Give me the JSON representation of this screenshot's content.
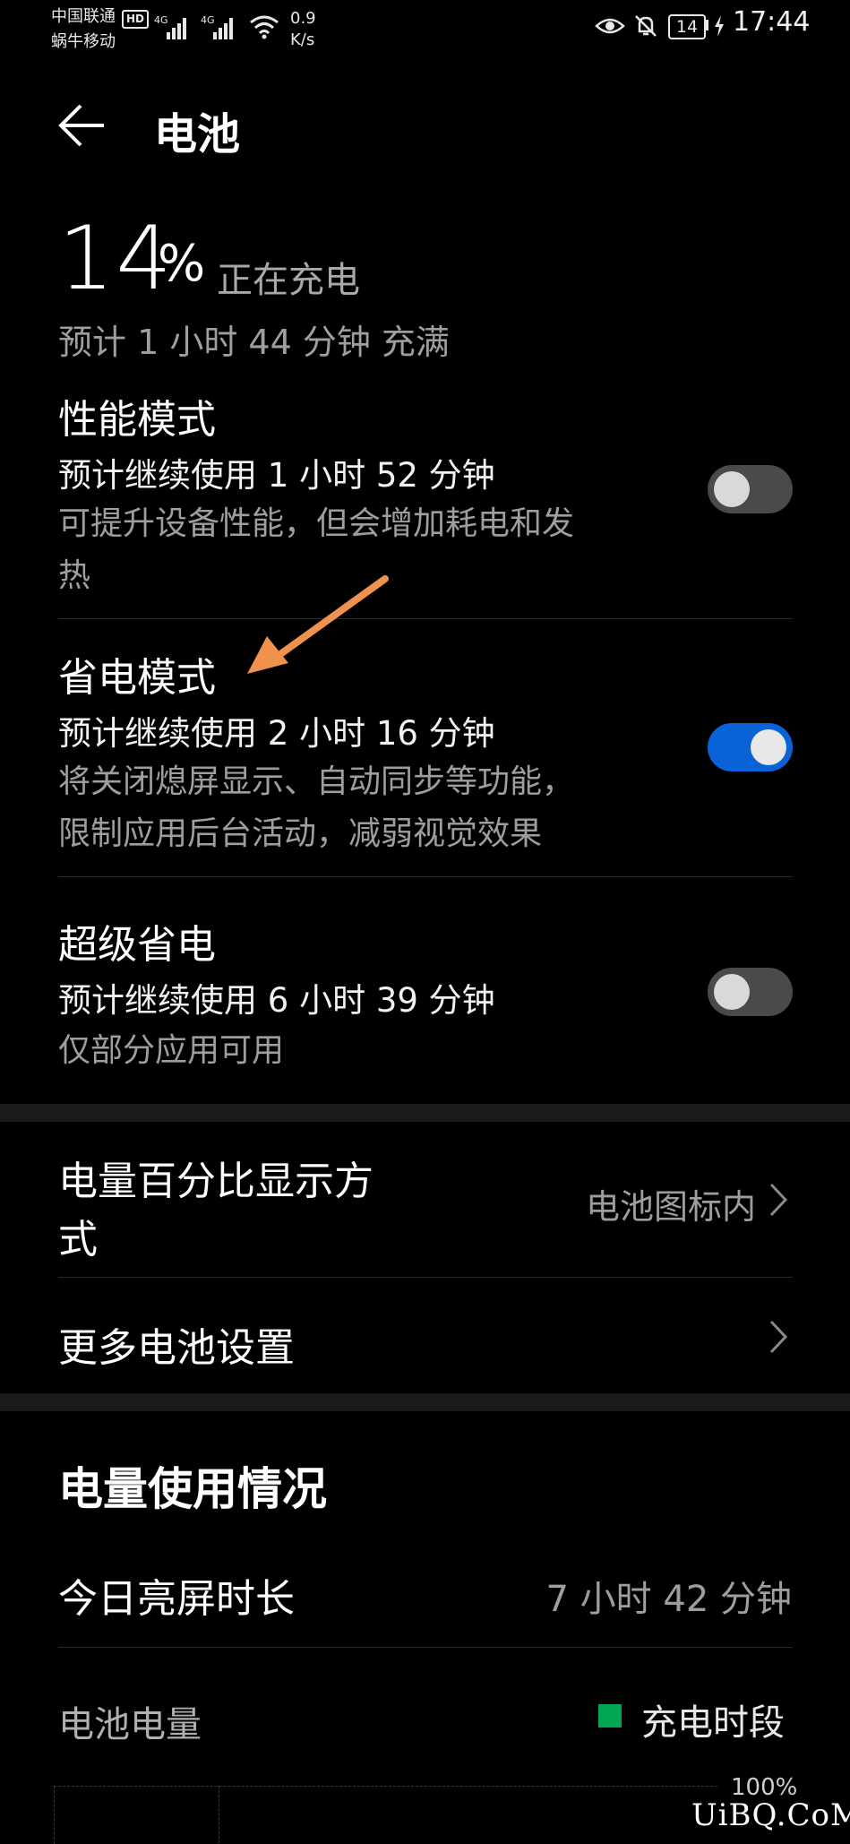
{
  "status_bar": {
    "carrier_1": "中国联通",
    "hd_badge": "HD",
    "carrier_2": "蜗牛移动",
    "net_1": "4G",
    "net_2": "4G",
    "speed_value": "0.9",
    "speed_unit": "K/s",
    "battery_level": "14",
    "time": "17:44",
    "icons": [
      "signal-icon",
      "wifi-icon",
      "eye-icon",
      "mute-bell-icon",
      "battery-icon",
      "charging-bolt-icon"
    ]
  },
  "header": {
    "back_icon": "back-arrow-icon",
    "title": "电池"
  },
  "battery_summary": {
    "percent": "14",
    "percent_sign": "%",
    "state": "正在充电",
    "full_charge_eta": "预计 1 小时 44 分钟 充满"
  },
  "modes": [
    {
      "title": "性能模式",
      "estimate": "预计继续使用 1 小时 52 分钟",
      "desc_line1": "可提升设备性能，但会增加耗电和发",
      "desc_line2": "热",
      "enabled": false
    },
    {
      "title": "省电模式",
      "estimate": "预计继续使用 2 小时 16 分钟",
      "desc_line1": "将关闭熄屏显示、自动同步等功能，",
      "desc_line2": "限制应用后台活动，减弱视觉效果",
      "enabled": true
    },
    {
      "title": "超级省电",
      "estimate": "预计继续使用 6 小时 39 分钟",
      "desc_line1": "仅部分应用可用",
      "enabled": false
    }
  ],
  "settings": {
    "percent_display_line1": "电量百分比显示方",
    "percent_display_line2": "式",
    "percent_display_value": "电池图标内",
    "more_settings": "更多电池设置"
  },
  "usage": {
    "section_title": "电量使用情况",
    "screen_on_label": "今日亮屏时长",
    "screen_on_value": "7 小时 42 分钟",
    "battery_level_label": "电池电量",
    "legend_label": "充电时段",
    "legend_color": "#00a651",
    "chart_top_label": "100%"
  },
  "colors": {
    "background": "#000000",
    "toggle_on": "#0a63d6",
    "toggle_off": "#4a4a4a",
    "annotation_arrow": "#f0924e"
  },
  "watermark": "UiBQ.CoM"
}
